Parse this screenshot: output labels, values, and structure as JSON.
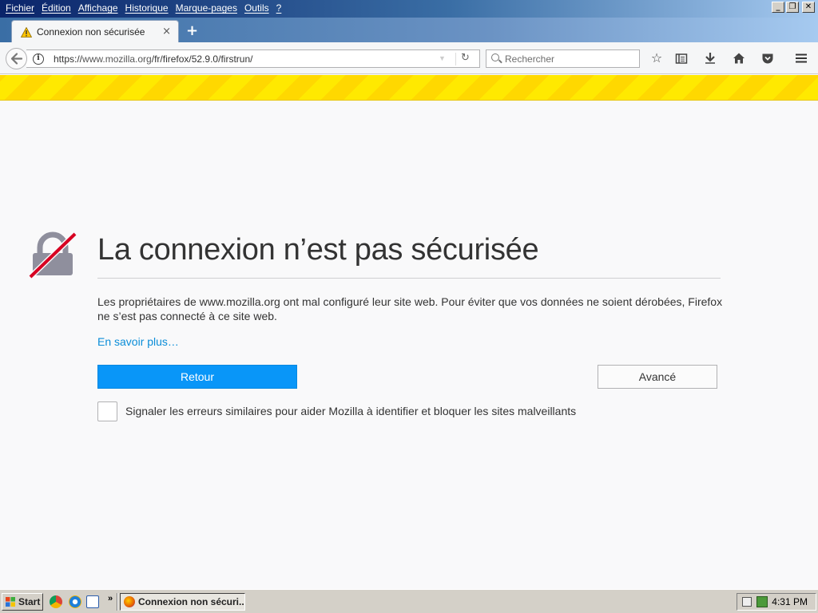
{
  "menu": [
    "Fichier",
    "Édition",
    "Affichage",
    "Historique",
    "Marque-pages",
    "Outils",
    "?"
  ],
  "tab": {
    "title": "Connexion non sécurisée",
    "close": "×",
    "new_tab": "+"
  },
  "url": {
    "scheme": "https://",
    "host": "www.mozilla.org",
    "path": "/fr/firefox/52.9.0/firstrun/"
  },
  "search": {
    "placeholder": "Rechercher"
  },
  "error": {
    "title": "La connexion n’est pas sécurisée",
    "description": "Les propriétaires de www.mozilla.org ont mal configuré leur site web. Pour éviter que vos données ne soient dérobées, Firefox ne s’est pas connecté à ce site web.",
    "learn_more": "En savoir plus…",
    "back_button": "Retour",
    "advanced_button": "Avancé",
    "report_label": "Signaler les erreurs similaires pour aider Mozilla à identifier et bloquer les sites malveillants"
  },
  "taskbar": {
    "start": "Start",
    "chevron": "»",
    "task_title": "Connexion non sécuri...",
    "clock": "4:31 PM"
  },
  "colors": {
    "primary_button": "#0996f8",
    "link": "#0a8dd8",
    "warning_stripe": "#ffe900"
  }
}
